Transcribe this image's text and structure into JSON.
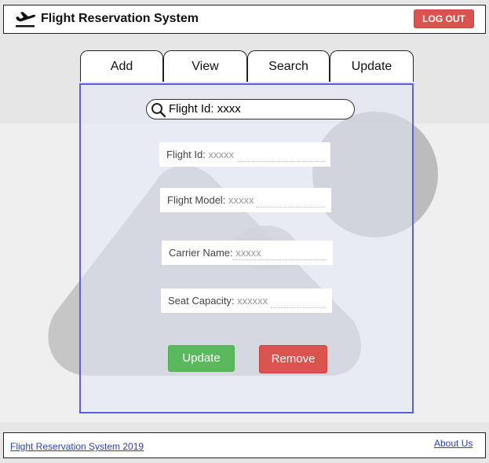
{
  "header": {
    "title": "Flight Reservation System",
    "logout_label": "LOG OUT"
  },
  "tabs": [
    {
      "label": "Add"
    },
    {
      "label": "View"
    },
    {
      "label": "Search"
    },
    {
      "label": "Update"
    }
  ],
  "search": {
    "value": "Flight Id: xxxx"
  },
  "form": {
    "fields": [
      {
        "label": "Flight Id:",
        "value": "xxxxx"
      },
      {
        "label": "Flight Model:",
        "value": "xxxxx"
      },
      {
        "label": "Carrier Name:",
        "value": "xxxxx"
      },
      {
        "label": "Seat Capacity:",
        "value": "xxxxxx"
      }
    ],
    "update_label": "Update",
    "remove_label": "Remove"
  },
  "footer": {
    "copyright": "Flight Reservation System 2019",
    "about_label": "About Us"
  },
  "colors": {
    "danger": "#d9534f",
    "success": "#5cb85c",
    "panel_border": "#5d5ee0",
    "link": "#2b3fb8"
  },
  "icons": [
    "plane-departure-icon",
    "search-icon",
    "image-placeholder-icon"
  ]
}
